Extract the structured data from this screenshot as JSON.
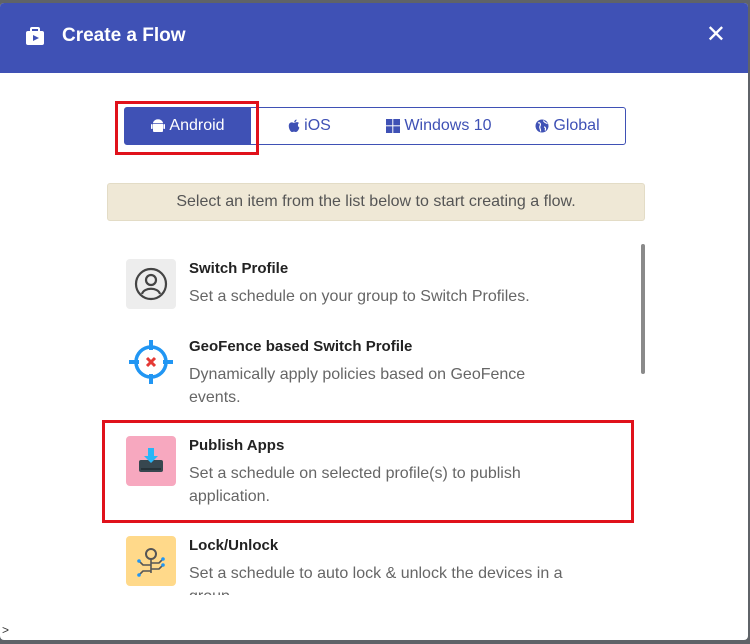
{
  "dialog": {
    "title": "Create a Flow",
    "close_label": "✕",
    "header_icon": "flow-icon",
    "accent_color": "#3f51b5"
  },
  "tabs": [
    {
      "label": "Android",
      "icon": "android-icon",
      "active": true
    },
    {
      "label": "iOS",
      "icon": "apple-icon",
      "active": false
    },
    {
      "label": "Windows 10",
      "icon": "windows-icon",
      "active": false
    },
    {
      "label": "Global",
      "icon": "globe-icon",
      "active": false
    }
  ],
  "info_message": "Select an item from the list below to start creating a flow.",
  "items": [
    {
      "title": "Switch Profile",
      "description": "Set a schedule on your group to Switch Profiles.",
      "icon": "user-circle-icon"
    },
    {
      "title": "GeoFence based Switch Profile",
      "description": "Dynamically apply policies based on GeoFence events.",
      "icon": "crosshair-icon"
    },
    {
      "title": "Publish Apps",
      "description": "Set a schedule on selected profile(s) to publish application.",
      "icon": "download-drive-icon"
    },
    {
      "title": "Lock/Unlock",
      "description": "Set a schedule to auto lock & unlock the devices in a group.",
      "icon": "lock-circuit-icon"
    }
  ],
  "footer_glyph": ">"
}
